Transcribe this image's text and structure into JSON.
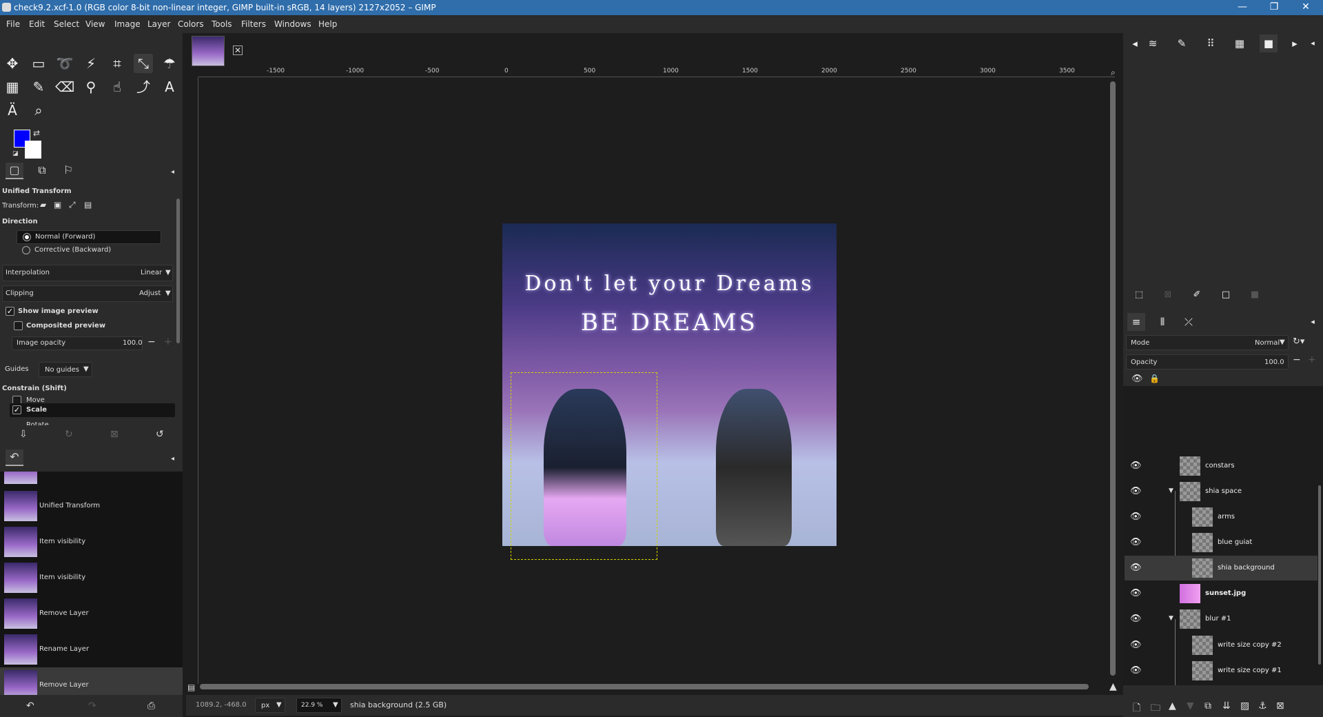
{
  "window": {
    "title": "check9.2.xcf-1.0 (RGB color 8-bit non-linear integer, GIMP built-in sRGB, 14 layers) 2127x2052 – GIMP",
    "minimize": "—",
    "maximize": "❐",
    "close": "✕"
  },
  "menu": [
    "File",
    "Edit",
    "Select",
    "View",
    "Image",
    "Layer",
    "Colors",
    "Tools",
    "Filters",
    "Windows",
    "Help"
  ],
  "tool_options": {
    "heading": "Unified Transform",
    "transform_label": "Transform:",
    "direction_label": "Direction",
    "direction_options": [
      "Normal (Forward)",
      "Corrective (Backward)"
    ],
    "interpolation_label": "Interpolation",
    "interpolation_value": "Linear",
    "clipping_label": "Clipping",
    "clipping_value": "Adjust",
    "show_preview": "Show image preview",
    "composited_preview": "Composited preview",
    "image_opacity_label": "Image opacity",
    "image_opacity_value": "100.0",
    "guides_label": "Guides",
    "guides_value": "No guides",
    "constrain_label": "Constrain (Shift)",
    "constrain_move": "Move",
    "constrain_scale": "Scale",
    "constrain_rotate": "Rotate"
  },
  "undo_history": [
    "Unified Transform",
    "Item visibility",
    "Item visibility",
    "Remove Layer",
    "Rename Layer",
    "Remove Layer"
  ],
  "rulers": {
    "top": [
      "-1500",
      "-1000",
      "-500",
      "0",
      "500",
      "1000",
      "1500",
      "2000",
      "2500",
      "3000",
      "3500"
    ]
  },
  "artwork": {
    "line1": "Don't let your Dreams",
    "line2": "BE DREAMS"
  },
  "status": {
    "coords": "1089.2, -468.0",
    "unit": "px",
    "zoom": "22.9 %",
    "message": "shia background (2.5 GB)"
  },
  "layers_panel": {
    "mode_label": "Mode",
    "mode_value": "Normal",
    "opacity_label": "Opacity",
    "opacity_value": "100.0",
    "layers": [
      {
        "name": "constars"
      },
      {
        "name": "shia space"
      },
      {
        "name": "arms"
      },
      {
        "name": "blue guiat"
      },
      {
        "name": "shia background"
      },
      {
        "name": "sunset.jpg"
      },
      {
        "name": "blur #1"
      },
      {
        "name": "write size copy #2"
      },
      {
        "name": "write size copy #1"
      }
    ]
  },
  "colors": {
    "foreground": "#0000ff",
    "background": "#ffffff",
    "selection": "#d4d400"
  }
}
